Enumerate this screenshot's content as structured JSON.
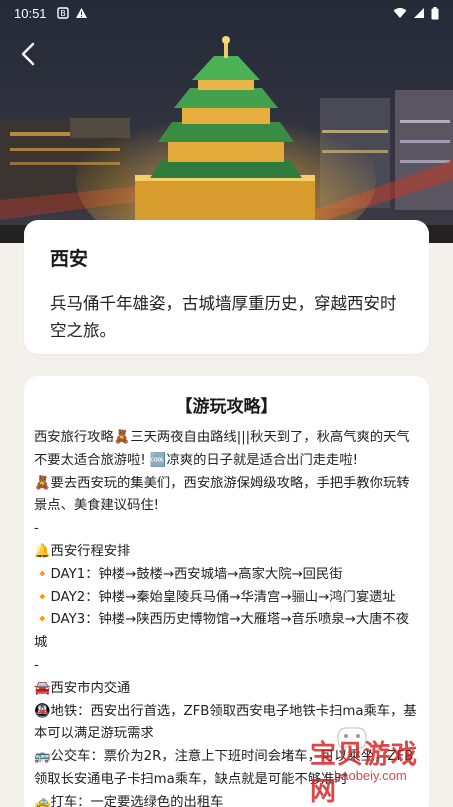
{
  "status_bar": {
    "time": "10:51"
  },
  "intro": {
    "city": "西安",
    "description": "兵马俑千年雄姿，古城墙厚重历史，穿越西安时空之旅。"
  },
  "guide": {
    "title": "【游玩攻略】",
    "lines": [
      "西安旅行攻略🧸三天两夜自由路线|||秋天到了，秋高气爽的天气不要太适合旅游啦! 🆒凉爽的日子就是适合出门走走啦!",
      "🧸要去西安玩的集美们，西安旅游保姆级攻略，手把手教你玩转景点、美食建议码住!",
      "-",
      "🔔西安行程安排",
      "🔸DAY1：钟楼→鼓楼→西安城墙→高家大院→回民街",
      "🔸DAY2：钟楼→秦始皇陵兵马俑→华清宫→骊山→鸿门宴遗址",
      "🔸DAY3：钟楼→陕西历史博物馆→大雁塔→音乐喷泉→大唐不夜城",
      "-",
      "🚘西安市内交通",
      "🚇地铁：西安出行首选，ZFB领取西安电子地铁卡扫ma乘车，基本可以满足游玩需求",
      "🚌公交车：票价为2R，注意上下班时间会堵车，可以乘坐，ZFB领取长安通电子卡扫ma乘车，缺点就是可能不够准时",
      "🚕打车：一定要选绿色的出租车"
    ]
  },
  "watermark": {
    "text": "宝贝游戏网",
    "url": "baobeiy.com"
  },
  "colors": {
    "page_bg": "#f4f1ec",
    "card_bg": "#ffffff",
    "watermark": "#d61e1e",
    "accent_orange": "#f5a623"
  }
}
